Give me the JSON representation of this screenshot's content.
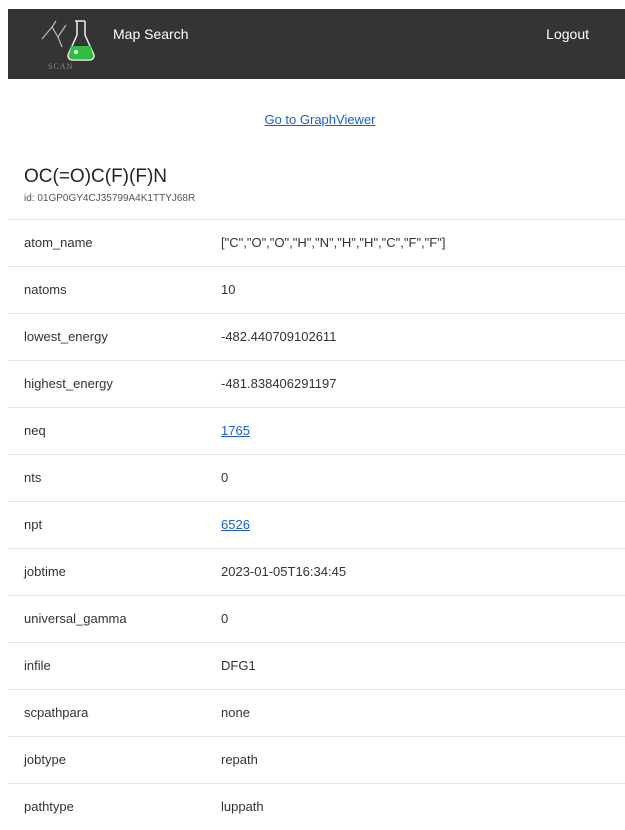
{
  "navbar": {
    "logo_text": "SCAN",
    "brand": "Map Search",
    "logout": "Logout",
    "colors": {
      "background": "#343434",
      "flask_liquid": "#2fbf3f"
    }
  },
  "graphviewer_link": "Go to GraphViewer",
  "record": {
    "title": "OC(=O)C(F)(F)N",
    "id_text": "id: 01GP0GY4CJ35799A4K1TTYJ68R"
  },
  "rows": [
    {
      "key": "atom_name",
      "value": "[\"C\",\"O\",\"O\",\"H\",\"N\",\"H\",\"H\",\"C\",\"F\",\"F\"]",
      "link": false
    },
    {
      "key": "natoms",
      "value": "10",
      "link": false
    },
    {
      "key": "lowest_energy",
      "value": "-482.440709102611",
      "link": false
    },
    {
      "key": "highest_energy",
      "value": "-481.838406291197",
      "link": false
    },
    {
      "key": "neq",
      "value": "1765",
      "link": true
    },
    {
      "key": "nts",
      "value": "0",
      "link": false
    },
    {
      "key": "npt",
      "value": "6526",
      "link": true
    },
    {
      "key": "jobtime",
      "value": "2023-01-05T16:34:45",
      "link": false
    },
    {
      "key": "universal_gamma",
      "value": "0",
      "link": false
    },
    {
      "key": "infile",
      "value": "DFG1",
      "link": false
    },
    {
      "key": "scpathpara",
      "value": "none",
      "link": false
    },
    {
      "key": "jobtype",
      "value": "repath",
      "link": false
    },
    {
      "key": "pathtype",
      "value": "luppath",
      "link": false
    }
  ]
}
